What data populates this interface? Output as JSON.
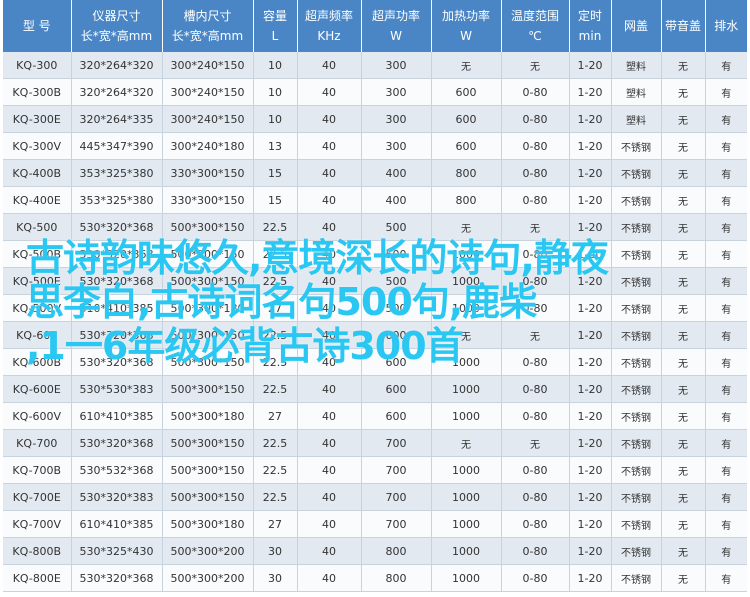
{
  "headers": [
    {
      "line1": "型 号",
      "line2": ""
    },
    {
      "line1": "仪器尺寸",
      "line2": "长*宽*高mm"
    },
    {
      "line1": "槽内尺寸",
      "line2": "长*宽*高mm"
    },
    {
      "line1": "容量",
      "line2": "L"
    },
    {
      "line1": "超声频率",
      "line2": "KHz"
    },
    {
      "line1": "超声功率",
      "line2": "W"
    },
    {
      "line1": "加热功率",
      "line2": "W"
    },
    {
      "line1": "温度范围",
      "line2": "℃"
    },
    {
      "line1": "定时",
      "line2": "min"
    },
    {
      "line1": "网盖",
      "line2": ""
    },
    {
      "line1": "带音盖",
      "line2": ""
    },
    {
      "line1": "排水",
      "line2": ""
    }
  ],
  "rows": [
    [
      "KQ-300",
      "320*264*320",
      "300*240*150",
      "10",
      "40",
      "300",
      "无",
      "无",
      "1-20",
      "塑料",
      "无",
      "有"
    ],
    [
      "KQ-300B",
      "320*264*320",
      "300*240*150",
      "10",
      "40",
      "300",
      "600",
      "0-80",
      "1-20",
      "塑料",
      "无",
      "有"
    ],
    [
      "KQ-300E",
      "320*264*335",
      "300*240*150",
      "10",
      "40",
      "300",
      "600",
      "0-80",
      "1-20",
      "塑料",
      "无",
      "有"
    ],
    [
      "KQ-300V",
      "445*347*390",
      "300*240*180",
      "13",
      "40",
      "300",
      "600",
      "0-80",
      "1-20",
      "不锈钢",
      "无",
      "有"
    ],
    [
      "KQ-400B",
      "353*325*380",
      "330*300*150",
      "15",
      "40",
      "400",
      "800",
      "0-80",
      "1-20",
      "不锈钢",
      "无",
      "有"
    ],
    [
      "KQ-400E",
      "353*325*380",
      "330*300*150",
      "15",
      "40",
      "400",
      "800",
      "0-80",
      "1-20",
      "不锈钢",
      "无",
      "有"
    ],
    [
      "KQ-500",
      "530*320*368",
      "500*300*150",
      "22.5",
      "40",
      "500",
      "无",
      "无",
      "1-20",
      "不锈钢",
      "无",
      "有"
    ],
    [
      "KQ-500B",
      "530*320*368",
      "500*300*150",
      "22.5",
      "40",
      "500",
      "1000",
      "0-80",
      "1-20",
      "不锈钢",
      "无",
      "有"
    ],
    [
      "KQ-500E",
      "530*320*368",
      "500*300*150",
      "22.5",
      "40",
      "500",
      "1000",
      "0-80",
      "1-20",
      "不锈钢",
      "无",
      "有"
    ],
    [
      "KQ-500V",
      "610*410*385",
      "500*300*180",
      "27",
      "40",
      "500",
      "1000",
      "0-80",
      "1-20",
      "不锈钢",
      "无",
      "有"
    ],
    [
      "KQ-600",
      "530*320*368",
      "500*300*150",
      "22.5",
      "40",
      "600",
      "无",
      "无",
      "1-20",
      "不锈钢",
      "无",
      "有"
    ],
    [
      "KQ-600B",
      "530*320*368",
      "500*300*150",
      "22.5",
      "40",
      "600",
      "1000",
      "0-80",
      "1-20",
      "不锈钢",
      "无",
      "有"
    ],
    [
      "KQ-600E",
      "530*530*383",
      "500*300*150",
      "22.5",
      "40",
      "600",
      "1000",
      "0-80",
      "1-20",
      "不锈钢",
      "无",
      "有"
    ],
    [
      "KQ-600V",
      "610*410*385",
      "500*300*180",
      "27",
      "40",
      "600",
      "1000",
      "0-80",
      "1-20",
      "不锈钢",
      "无",
      "有"
    ],
    [
      "KQ-700",
      "530*320*368",
      "500*300*150",
      "22.5",
      "40",
      "700",
      "无",
      "无",
      "1-20",
      "不锈钢",
      "无",
      "有"
    ],
    [
      "KQ-700B",
      "530*532*368",
      "500*300*150",
      "22.5",
      "40",
      "700",
      "1000",
      "0-80",
      "1-20",
      "不锈钢",
      "无",
      "有"
    ],
    [
      "KQ-700E",
      "530*320*383",
      "500*300*150",
      "22.5",
      "40",
      "700",
      "1000",
      "0-80",
      "1-20",
      "不锈钢",
      "无",
      "有"
    ],
    [
      "KQ-700V",
      "610*410*385",
      "500*300*180",
      "27",
      "40",
      "700",
      "1000",
      "0-80",
      "1-20",
      "不锈钢",
      "无",
      "有"
    ],
    [
      "KQ-800B",
      "530*325*430",
      "500*300*200",
      "30",
      "40",
      "800",
      "1000",
      "0-80",
      "1-20",
      "不锈钢",
      "无",
      "有"
    ],
    [
      "KQ-800E",
      "530*320*368",
      "500*300*200",
      "30",
      "40",
      "800",
      "1000",
      "0-80",
      "1-20",
      "不锈钢",
      "无",
      "有"
    ]
  ],
  "overlay": {
    "lines": [
      "古诗韵味悠久,意境深长的诗句,静夜",
      "思李白,古诗词名句500句,鹿柴",
      ",1一6年级必背古诗300首"
    ]
  },
  "colors": {
    "header_bg": "#4a86c5",
    "row_alt": "#e3e9f1",
    "overlay_text": "#29c7f2"
  }
}
